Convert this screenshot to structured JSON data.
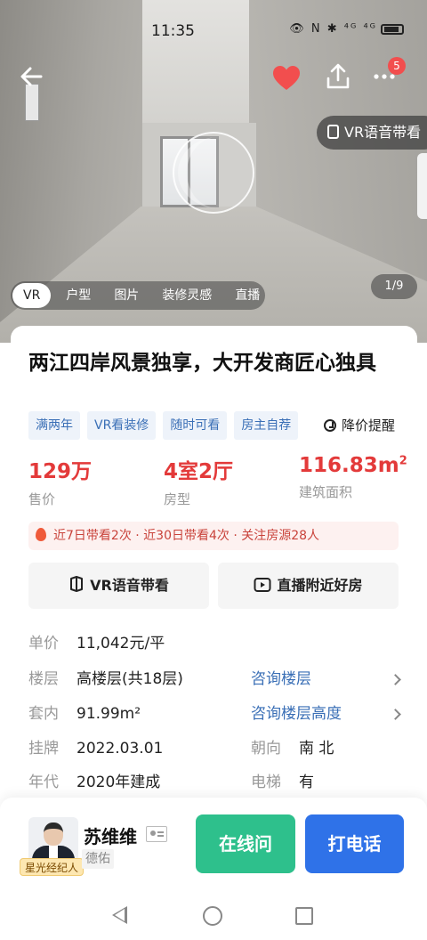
{
  "status_bar": {
    "time": "11:35",
    "icons": "👁 N ✱ ⁴ᴳ ⁴ᴳ"
  },
  "hero": {
    "vr_voice_label": "VR语音带看",
    "media_tabs": [
      "VR",
      "户型",
      "图片",
      "装修灵感",
      "直播"
    ],
    "active_tab": "VR",
    "photo_counter": "1/9",
    "more_badge_count": "5",
    "favorite_color": "#f24e4e"
  },
  "listing": {
    "title": "两江四岸风景独享，大开发商匠心独具",
    "tags": [
      "满两年",
      "VR看装修",
      "随时可看",
      "房主自荐"
    ],
    "price_alert": "降价提醒",
    "stats": [
      {
        "value": "129万",
        "label": "售价"
      },
      {
        "value": "4室2厅",
        "label": "房型"
      },
      {
        "value": "116.83m",
        "sup": "2",
        "label": "建筑面积"
      }
    ],
    "hot_info": "近7日带看2次 · 近30日带看4次 · 关注房源28人",
    "actions": {
      "vr_tour": "VR语音带看",
      "live_nearby": "直播附近好房"
    },
    "details": {
      "unit_price_label": "单价",
      "unit_price": "11,042元/平",
      "floor_label": "楼层",
      "floor": "高楼层(共18层)",
      "floor_link": "咨询楼层",
      "inner_label": "套内",
      "inner_area": "91.99m²",
      "height_link": "咨询楼层高度",
      "listed_label": "挂牌",
      "listed_date": "2022.03.01",
      "facing_label": "朝向",
      "facing": "南 北",
      "year_label": "年代",
      "year": "2020年建成",
      "elevator_label": "电梯",
      "elevator": "有"
    }
  },
  "agent": {
    "name": "苏维维",
    "company": "德佑",
    "badge": "星光经纪人",
    "chat_label": "在线问",
    "call_label": "打电话",
    "chat_color": "#2ec08c",
    "call_color": "#2f72e8"
  },
  "colors": {
    "price_red": "#e33a3a",
    "link_blue": "#3a6fb6"
  }
}
